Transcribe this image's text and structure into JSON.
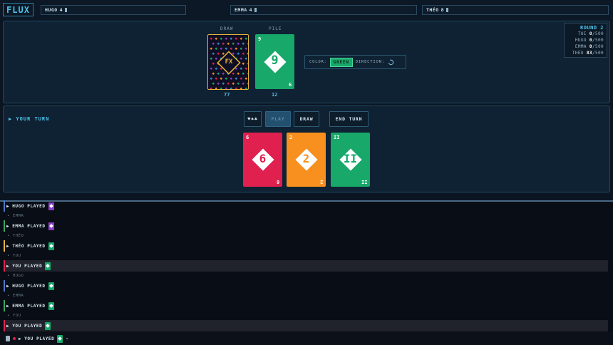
{
  "app": {
    "logo": "FLUX"
  },
  "players_bar": [
    {
      "name": "HUGO",
      "count": "4"
    },
    {
      "name": "EMMA",
      "count": "4"
    },
    {
      "name": "THÉO",
      "count": "8"
    }
  ],
  "table": {
    "draw_label": "DRAW",
    "pile_label": "PILE",
    "draw_count": "77",
    "pile_count": "12",
    "deck_logo": "FX",
    "pile_card": {
      "value": "9",
      "color": "#17a86a"
    },
    "color_label": "COLOR:",
    "color_value": "GREEN",
    "direction_label": "DIRECTION:",
    "direction_icon": "clockwise-arrow-icon"
  },
  "scoreboard": {
    "title": "ROUND 2",
    "rows": [
      {
        "name": "TOI",
        "score": "0",
        "max": "/500"
      },
      {
        "name": "HUGO",
        "score": "0",
        "max": "/500"
      },
      {
        "name": "EMMA",
        "score": "0",
        "max": "/500"
      },
      {
        "name": "THÉO",
        "score": "83",
        "max": "/500"
      }
    ]
  },
  "hand": {
    "turn_label": "▶ YOUR TURN",
    "sort_label": "♥♠♣",
    "play_label": "PLAY",
    "draw_label": "DRAW",
    "end_turn_label": "END TURN",
    "cards": [
      {
        "value": "6",
        "color": "#e0204f",
        "text_color": "#e0204f"
      },
      {
        "value": "2",
        "color": "#f7901e",
        "text_color": "#f7901e"
      },
      {
        "value": "II",
        "color": "#17a86a",
        "text_color": "#17a86a"
      }
    ]
  },
  "log": {
    "rows": [
      {
        "text": "HUGO PLAYED",
        "accent": "#4a78c8",
        "mini": "#8a3fc4",
        "you": false
      },
      {
        "text": "EMMA PLAYED",
        "accent": "#38a85c",
        "mini": "#8a3fc4",
        "you": false
      },
      {
        "text": "THÉO PLAYED",
        "accent": "#e6b43a",
        "mini": "#17a86a",
        "you": false
      },
      {
        "text": "YOU PLAYED",
        "accent": "#e0204f",
        "mini": "#17a86a",
        "you": true
      },
      {
        "text": "HUGO PLAYED",
        "accent": "#4a78c8",
        "mini": "#17a86a",
        "you": false
      },
      {
        "text": "EMMA PLAYED",
        "accent": "#38a85c",
        "mini": "#17a86a",
        "you": false
      },
      {
        "text": "YOU PLAYED",
        "accent": "#e0204f",
        "mini": "#17a86a",
        "you": true
      }
    ],
    "separators": [
      "EMMA",
      "THÉO",
      "YOU",
      "HUGO",
      "EMMA",
      "YOU"
    ],
    "bottom_text": "YOU PLAYED",
    "bottom_suffix": "-"
  }
}
